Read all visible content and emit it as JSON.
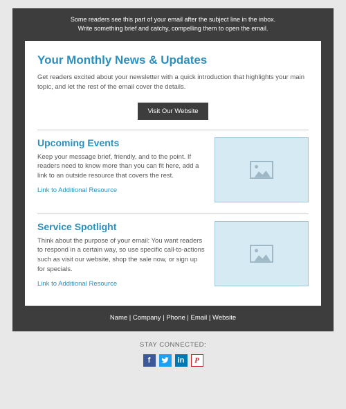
{
  "preheader": {
    "line1": "Some readers see this part of your email after the subject line in the inbox.",
    "line2": "Write something brief and catchy, compelling them to open the email."
  },
  "headline": "Your Monthly News & Updates",
  "intro": "Get readers excited about your newsletter with a quick introduction that highlights your main topic, and let the rest of the email cover the details.",
  "cta_button": "Visit Our Website",
  "sections": [
    {
      "title": "Upcoming Events",
      "body": "Keep your message brief, friendly, and to the point. If readers need to know more than you can fit here, add a link to an outside resource that covers the rest.",
      "link": "Link to Additional Resource"
    },
    {
      "title": "Service Spotlight",
      "body": "Think about the purpose of your email: You want readers to respond in a certain way, so use specific call-to-actions such as visit our website, shop the sale now, or sign up for specials.",
      "link": "Link to Additional Resource"
    }
  ],
  "footer_contact": "Name | Company | Phone | Email | Website",
  "stay_connected": "STAY CONNECTED:",
  "social": {
    "facebook": "f",
    "twitter": "t",
    "linkedin": "in",
    "pinterest": "P"
  },
  "colors": {
    "accent": "#2a8fbd",
    "dark": "#3d3d3d",
    "placeholder_bg": "#d6eaf4"
  }
}
